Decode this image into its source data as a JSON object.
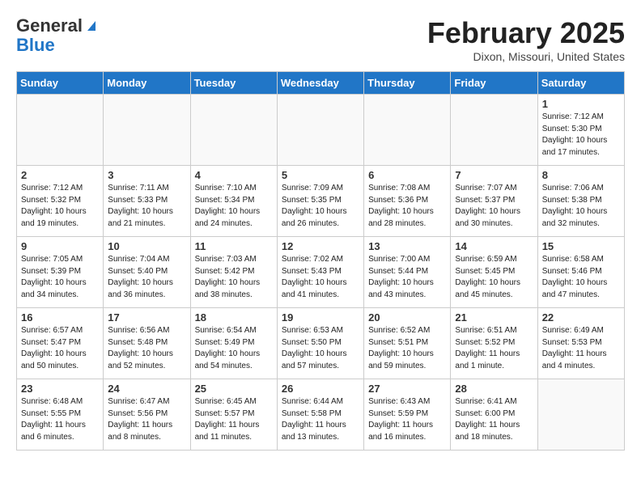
{
  "header": {
    "logo_general": "General",
    "logo_blue": "Blue",
    "month_title": "February 2025",
    "location": "Dixon, Missouri, United States"
  },
  "days_of_week": [
    "Sunday",
    "Monday",
    "Tuesday",
    "Wednesday",
    "Thursday",
    "Friday",
    "Saturday"
  ],
  "weeks": [
    [
      {
        "day": "",
        "info": ""
      },
      {
        "day": "",
        "info": ""
      },
      {
        "day": "",
        "info": ""
      },
      {
        "day": "",
        "info": ""
      },
      {
        "day": "",
        "info": ""
      },
      {
        "day": "",
        "info": ""
      },
      {
        "day": "1",
        "info": "Sunrise: 7:12 AM\nSunset: 5:30 PM\nDaylight: 10 hours\nand 17 minutes."
      }
    ],
    [
      {
        "day": "2",
        "info": "Sunrise: 7:12 AM\nSunset: 5:32 PM\nDaylight: 10 hours\nand 19 minutes."
      },
      {
        "day": "3",
        "info": "Sunrise: 7:11 AM\nSunset: 5:33 PM\nDaylight: 10 hours\nand 21 minutes."
      },
      {
        "day": "4",
        "info": "Sunrise: 7:10 AM\nSunset: 5:34 PM\nDaylight: 10 hours\nand 24 minutes."
      },
      {
        "day": "5",
        "info": "Sunrise: 7:09 AM\nSunset: 5:35 PM\nDaylight: 10 hours\nand 26 minutes."
      },
      {
        "day": "6",
        "info": "Sunrise: 7:08 AM\nSunset: 5:36 PM\nDaylight: 10 hours\nand 28 minutes."
      },
      {
        "day": "7",
        "info": "Sunrise: 7:07 AM\nSunset: 5:37 PM\nDaylight: 10 hours\nand 30 minutes."
      },
      {
        "day": "8",
        "info": "Sunrise: 7:06 AM\nSunset: 5:38 PM\nDaylight: 10 hours\nand 32 minutes."
      }
    ],
    [
      {
        "day": "9",
        "info": "Sunrise: 7:05 AM\nSunset: 5:39 PM\nDaylight: 10 hours\nand 34 minutes."
      },
      {
        "day": "10",
        "info": "Sunrise: 7:04 AM\nSunset: 5:40 PM\nDaylight: 10 hours\nand 36 minutes."
      },
      {
        "day": "11",
        "info": "Sunrise: 7:03 AM\nSunset: 5:42 PM\nDaylight: 10 hours\nand 38 minutes."
      },
      {
        "day": "12",
        "info": "Sunrise: 7:02 AM\nSunset: 5:43 PM\nDaylight: 10 hours\nand 41 minutes."
      },
      {
        "day": "13",
        "info": "Sunrise: 7:00 AM\nSunset: 5:44 PM\nDaylight: 10 hours\nand 43 minutes."
      },
      {
        "day": "14",
        "info": "Sunrise: 6:59 AM\nSunset: 5:45 PM\nDaylight: 10 hours\nand 45 minutes."
      },
      {
        "day": "15",
        "info": "Sunrise: 6:58 AM\nSunset: 5:46 PM\nDaylight: 10 hours\nand 47 minutes."
      }
    ],
    [
      {
        "day": "16",
        "info": "Sunrise: 6:57 AM\nSunset: 5:47 PM\nDaylight: 10 hours\nand 50 minutes."
      },
      {
        "day": "17",
        "info": "Sunrise: 6:56 AM\nSunset: 5:48 PM\nDaylight: 10 hours\nand 52 minutes."
      },
      {
        "day": "18",
        "info": "Sunrise: 6:54 AM\nSunset: 5:49 PM\nDaylight: 10 hours\nand 54 minutes."
      },
      {
        "day": "19",
        "info": "Sunrise: 6:53 AM\nSunset: 5:50 PM\nDaylight: 10 hours\nand 57 minutes."
      },
      {
        "day": "20",
        "info": "Sunrise: 6:52 AM\nSunset: 5:51 PM\nDaylight: 10 hours\nand 59 minutes."
      },
      {
        "day": "21",
        "info": "Sunrise: 6:51 AM\nSunset: 5:52 PM\nDaylight: 11 hours\nand 1 minute."
      },
      {
        "day": "22",
        "info": "Sunrise: 6:49 AM\nSunset: 5:53 PM\nDaylight: 11 hours\nand 4 minutes."
      }
    ],
    [
      {
        "day": "23",
        "info": "Sunrise: 6:48 AM\nSunset: 5:55 PM\nDaylight: 11 hours\nand 6 minutes."
      },
      {
        "day": "24",
        "info": "Sunrise: 6:47 AM\nSunset: 5:56 PM\nDaylight: 11 hours\nand 8 minutes."
      },
      {
        "day": "25",
        "info": "Sunrise: 6:45 AM\nSunset: 5:57 PM\nDaylight: 11 hours\nand 11 minutes."
      },
      {
        "day": "26",
        "info": "Sunrise: 6:44 AM\nSunset: 5:58 PM\nDaylight: 11 hours\nand 13 minutes."
      },
      {
        "day": "27",
        "info": "Sunrise: 6:43 AM\nSunset: 5:59 PM\nDaylight: 11 hours\nand 16 minutes."
      },
      {
        "day": "28",
        "info": "Sunrise: 6:41 AM\nSunset: 6:00 PM\nDaylight: 11 hours\nand 18 minutes."
      },
      {
        "day": "",
        "info": ""
      }
    ]
  ]
}
